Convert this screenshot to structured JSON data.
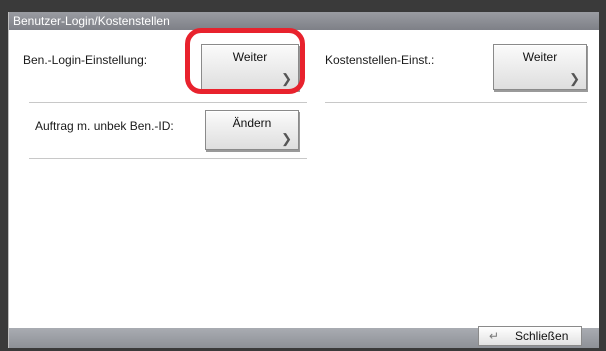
{
  "window": {
    "title": "Benutzer-Login/Kostenstellen"
  },
  "settings": {
    "login_setting": {
      "label": "Ben.-Login-Einstellung:",
      "button": "Weiter"
    },
    "cost_center": {
      "label": "Kostenstellen-Einst.:",
      "button": "Weiter"
    },
    "unknown_id_job": {
      "label": "Auftrag m. unbek Ben.-ID:",
      "button": "Ändern"
    }
  },
  "footer": {
    "close_label": "Schließen"
  },
  "colors": {
    "highlight": "#e8222d",
    "titlebar": "#8a8c92"
  }
}
